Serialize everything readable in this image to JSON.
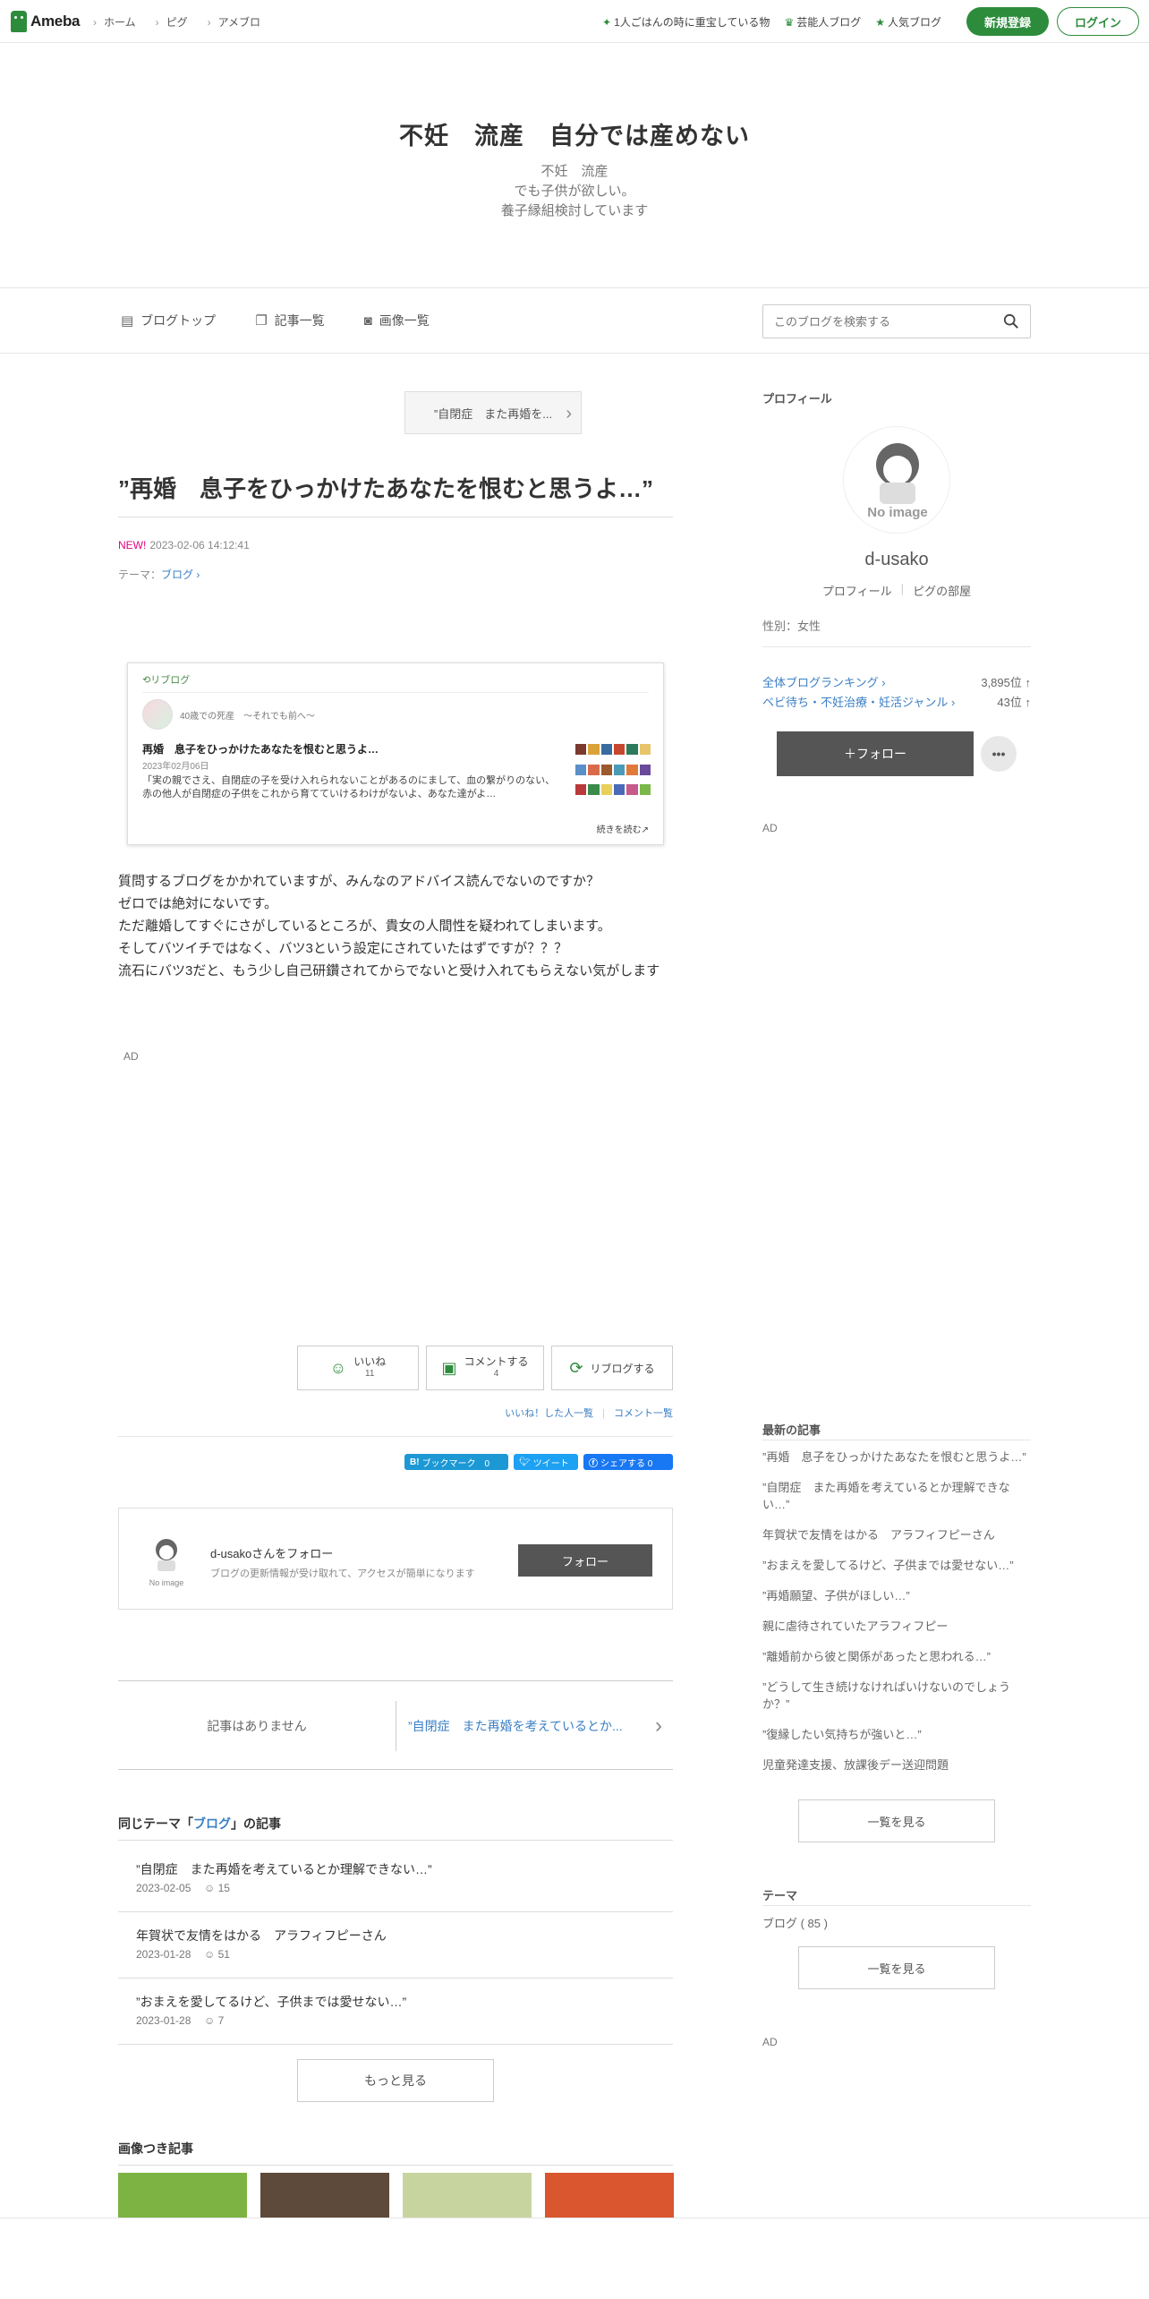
{
  "header": {
    "logo_text": "Ameba",
    "breadcrumbs": [
      "ホーム",
      "ピグ",
      "アメブロ"
    ],
    "links": [
      {
        "label": "1人ごはんの時に重宝している物",
        "icon": "sparkle-icon"
      },
      {
        "label": "芸能人ブログ",
        "icon": "crown-icon"
      },
      {
        "label": "人気ブログ",
        "icon": "star-icon"
      }
    ],
    "register_label": "新規登録",
    "login_label": "ログイン"
  },
  "blog": {
    "title": "不妊　流産　自分では産めない",
    "description": [
      "不妊　流産",
      "でも子供が欲しい。",
      "養子縁組検討しています"
    ]
  },
  "nav": {
    "items": [
      {
        "label": "ブログトップ",
        "icon": "document-icon"
      },
      {
        "label": "記事一覧",
        "icon": "copy-icon"
      },
      {
        "label": "画像一覧",
        "icon": "camera-icon"
      }
    ],
    "search_placeholder": "このブログを検索する"
  },
  "entry": {
    "prev_label": "”自閉症　また再婚を...",
    "title": "”再婚　息子をひっかけたあなたを恨むと思うよ…”",
    "new_badge": "NEW!",
    "datetime": "2023-02-06 14:12:41",
    "theme_prefix": "テーマ：",
    "theme": "ブログ",
    "reblog": {
      "label": "リブログ",
      "author_blog": "40歳での死産　〜それでも前へ〜",
      "title": "再婚　息子をひっかけたあなたを恨むと思うよ…",
      "date": "2023年02月06日",
      "excerpt": "「実の親でさえ、自閉症の子を受け入れられないことがあるのにまして、血の繋がりのない、赤の他人が自閉症の子供をこれから育てていけるわけがないよ、あなた達がよ…",
      "more": "続きを読む",
      "thumb_colors": [
        "#7a3b2e",
        "#d9a33a",
        "#3a6b9e",
        "#c7472e",
        "#2e7a5b",
        "#e8c46a",
        "#5a8fc7",
        "#d96b4a",
        "#9a5a2e",
        "#4a9ab8",
        "#e07a3a",
        "#6a4a9a",
        "#b83a3a",
        "#3a8a4a",
        "#e8d05a",
        "#4a6ab8",
        "#c75a8a",
        "#7ab84a"
      ]
    },
    "body": [
      "質問するブログをかかれていますが、みんなのアドバイス読んでないのですか？",
      "ゼロでは絶対にないです。",
      "ただ離婚してすぐにさがしているところが、貴女の人間性を疑われてしまいます。",
      "そしてバツイチではなく、バツ3という設定にされていたはずですが？？？",
      "流石にバツ3だと、もう少し自己研鑽されてからでないと受け入れてもらえない気がします"
    ],
    "ad_label": "AD",
    "actions": {
      "like_label": "いいね",
      "like_count": "11",
      "comment_label": "コメントする",
      "comment_count": "4",
      "reblog_label": "リブログする"
    },
    "like_users_link": "いいね！した人一覧",
    "comments_link": "コメント一覧",
    "share": {
      "hatena": "ブックマーク　0",
      "tweet": "ツイート",
      "facebook": "シェアする 0"
    },
    "follow_box": {
      "name": "d-usakoさんをフォロー",
      "subtitle": "ブログの更新情報が受け取れて、アクセスが簡単になります",
      "button": "フォロー",
      "no_image": "No image"
    },
    "pager": {
      "none": "記事はありません",
      "next": "”自閉症　また再婚を考えているとか..."
    }
  },
  "same_theme": {
    "prefix": "同じテーマ「",
    "theme": "ブログ",
    "suffix": "」の記事",
    "entries": [
      {
        "title": "”自閉症　また再婚を考えているとか理解できない…”",
        "date": "2023-02-05",
        "likes": "15"
      },
      {
        "title": "年賀状で友情をはかる　アラフィフピーさん",
        "date": "2023-01-28",
        "likes": "51"
      },
      {
        "title": "”おまえを愛してるけど、子供までは愛せない…”",
        "date": "2023-01-28",
        "likes": "7"
      }
    ],
    "more_label": "もっと見る"
  },
  "image_entries": {
    "title": "画像つき記事",
    "thumb_colors": [
      "#7cb342",
      "#5d4a3a",
      "#c8d4a0",
      "#d9562e"
    ]
  },
  "sidebar": {
    "profile_title": "プロフィール",
    "no_image": "No image",
    "name": "d-usako",
    "profile_link": "プロフィール",
    "pig_link": "ピグの部屋",
    "gender": "性別：女性",
    "rankings": [
      {
        "label": "全体ブログランキング",
        "value": "3,895位 ↑"
      },
      {
        "label": "ベビ待ち・不妊治療・妊活ジャンル",
        "value": "43位 ↑"
      }
    ],
    "follow_label": "＋フォロー",
    "more_label": "•••",
    "ad_label": "AD",
    "recent_title": "最新の記事",
    "recent": [
      "”再婚　息子をひっかけたあなたを恨むと思うよ…”",
      "”自閉症　また再婚を考えているとか理解できない…”",
      "年賀状で友情をはかる　アラフィフピーさん",
      "”おまえを愛してるけど、子供までは愛せない…”",
      "”再婚願望、子供がほしい…”",
      "親に虐待されていたアラフィフピー",
      "”離婚前から彼と関係があったと思われる…”",
      "”どうして生き続けなければいけないのでしょうか？”",
      "”復縁したい気持ちが強いと…”",
      "児童発達支援、放課後デー送迎問題"
    ],
    "list_button": "一覧を見る",
    "theme_title": "テーマ",
    "theme_item": "ブログ ( 85 )"
  },
  "colors": {
    "brand_green": "#2d8c3c",
    "link_blue": "#3b7fc4",
    "new_pink": "#e4007f"
  }
}
